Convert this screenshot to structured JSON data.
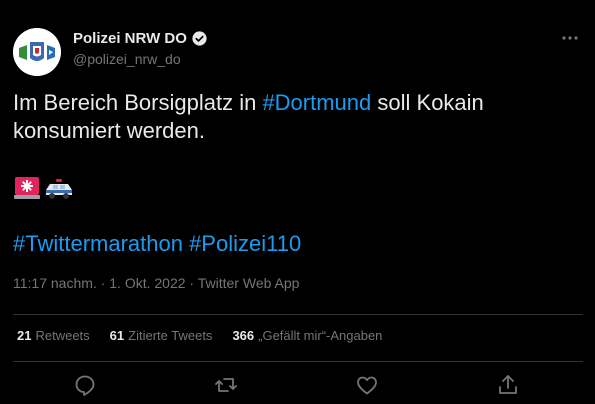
{
  "author": {
    "name": "Polizei NRW DO",
    "handle": "@polizei_nrw_do"
  },
  "tweet": {
    "text_parts": [
      "Im Bereich Borsigplatz in ",
      "#Dortmund",
      " soll Kokain konsumiert werden."
    ],
    "emojis": [
      "siren-emoji",
      "police-car-emoji"
    ],
    "hashtags": "#Twittermarathon #Polizei110",
    "time": "11:17 nachm.",
    "date": "1. Okt. 2022",
    "client": "Twitter Web App",
    "sep": "·"
  },
  "stats": {
    "retweets_count": "21",
    "retweets_label": "Retweets",
    "quotes_count": "61",
    "quotes_label": "Zitierte Tweets",
    "likes_count": "366",
    "likes_label": "„Gefällt mir“-Angaben"
  },
  "colors": {
    "background": "#000000",
    "text": "#e7e9ea",
    "muted": "#71767b",
    "link": "#1d9bf0",
    "divider": "#2f3336"
  }
}
